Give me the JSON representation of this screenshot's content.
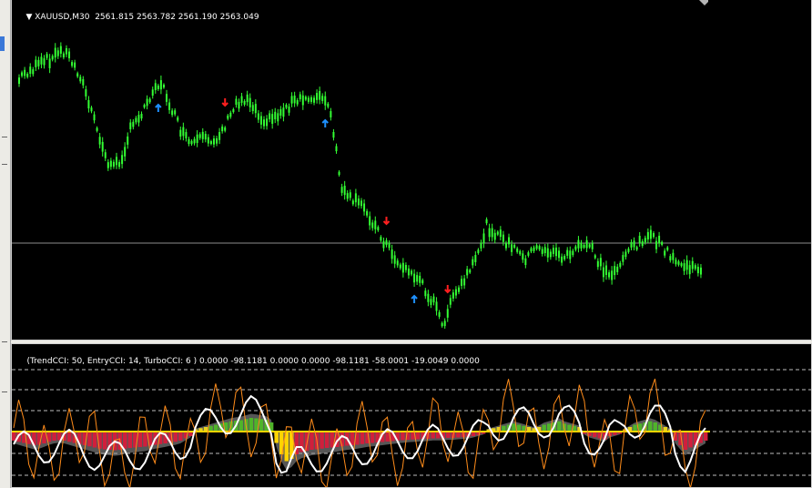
{
  "chart_data": [
    {
      "type": "candlestick",
      "symbol_header": "XAUUSD,M30",
      "ohlc_text": "2561.815 2563.782 2561.190 2563.049",
      "bid_level": 2563.049,
      "price_path": [
        60,
        52,
        50,
        46,
        42,
        38,
        36,
        30,
        28,
        34,
        45,
        55,
        75,
        95,
        115,
        135,
        150,
        155,
        150,
        135,
        115,
        105,
        95,
        85,
        70,
        65,
        70,
        85,
        100,
        115,
        125,
        130,
        128,
        125,
        127,
        125,
        120,
        110,
        100,
        85,
        82,
        80,
        86,
        98,
        102,
        104,
        100,
        96,
        90,
        85,
        84,
        82,
        80,
        78,
        80,
        82,
        100,
        140,
        180,
        190,
        192,
        196,
        200,
        210,
        220,
        232,
        240,
        250,
        260,
        265,
        270,
        275,
        280,
        290,
        300,
        310,
        330,
        315,
        300,
        290,
        280,
        270,
        260,
        240,
        220,
        225,
        230,
        235,
        240,
        245,
        252,
        255,
        250,
        245,
        245,
        248,
        250,
        252,
        255,
        250,
        245,
        244,
        242,
        242,
        260,
        268,
        275,
        270,
        260,
        250,
        245,
        240,
        235,
        232,
        235,
        240,
        245,
        255,
        260,
        262,
        265,
        268,
        266,
        268
      ],
      "signals": [
        {
          "type": "buy",
          "index": 25
        },
        {
          "type": "sell",
          "index": 37
        },
        {
          "type": "buy",
          "index": 55
        },
        {
          "type": "sell",
          "index": 66
        },
        {
          "type": "buy",
          "index": 71
        },
        {
          "type": "sell",
          "index": 77
        }
      ],
      "colors": {
        "candle": "#33ff33",
        "buy": "#1e90ff",
        "sell": "#ff1f1f",
        "level": "#8c8c8c"
      }
    },
    {
      "type": "histogram+lines",
      "indicator_label": "(TrendCCI: 50, EntryCCI: 14, TurboCCI: 6 )",
      "indicator_values": "0.0000 -98.1181 0.0000 0.0000 -98.1181 -58.0001 -19.0049 0.0000",
      "histogram": [
        -40,
        -45,
        -50,
        -55,
        -60,
        -58,
        -52,
        -45,
        -40,
        -38,
        -40,
        -45,
        -50,
        -55,
        -60,
        -65,
        -70,
        -75,
        -78,
        -80,
        -82,
        -80,
        -75,
        -72,
        -70,
        -68,
        -66,
        -62,
        -58,
        -55,
        -52,
        -48,
        -45,
        -40,
        -30,
        -20,
        10,
        15,
        20,
        25,
        30,
        35,
        40,
        45,
        48,
        50,
        55,
        60,
        58,
        55,
        52,
        40,
        -50,
        -100,
        -130,
        -120,
        -100,
        -90,
        -85,
        -80,
        -78,
        -75,
        -72,
        -70,
        -68,
        -65,
        -62,
        -60,
        -58,
        -55,
        -52,
        -50,
        -48,
        -46,
        -44,
        -42,
        -40,
        -38,
        -36,
        -35,
        -34,
        -33,
        -32,
        -30,
        -30,
        -30,
        -28,
        -28,
        -26,
        -25,
        -24,
        -20,
        -15,
        -10,
        10,
        15,
        20,
        25,
        30,
        35,
        30,
        25,
        20,
        15,
        20,
        30,
        35,
        40,
        45,
        35,
        30,
        25,
        20,
        -10,
        -20,
        -25,
        -30,
        -35,
        -20,
        -15,
        -10,
        10,
        20,
        30,
        35,
        40,
        45,
        40,
        30,
        20,
        10,
        -40,
        -60,
        -80,
        -70,
        -60,
        -50,
        -40
      ],
      "colors": {
        "up": "#4fb42a",
        "up_light": "#e6d21e",
        "down": "#d01f3c",
        "zero": "#ffd400",
        "white_line": "#ffffff",
        "orange_line": "#ff8c1a",
        "area": "#9c9c9c"
      }
    }
  ]
}
